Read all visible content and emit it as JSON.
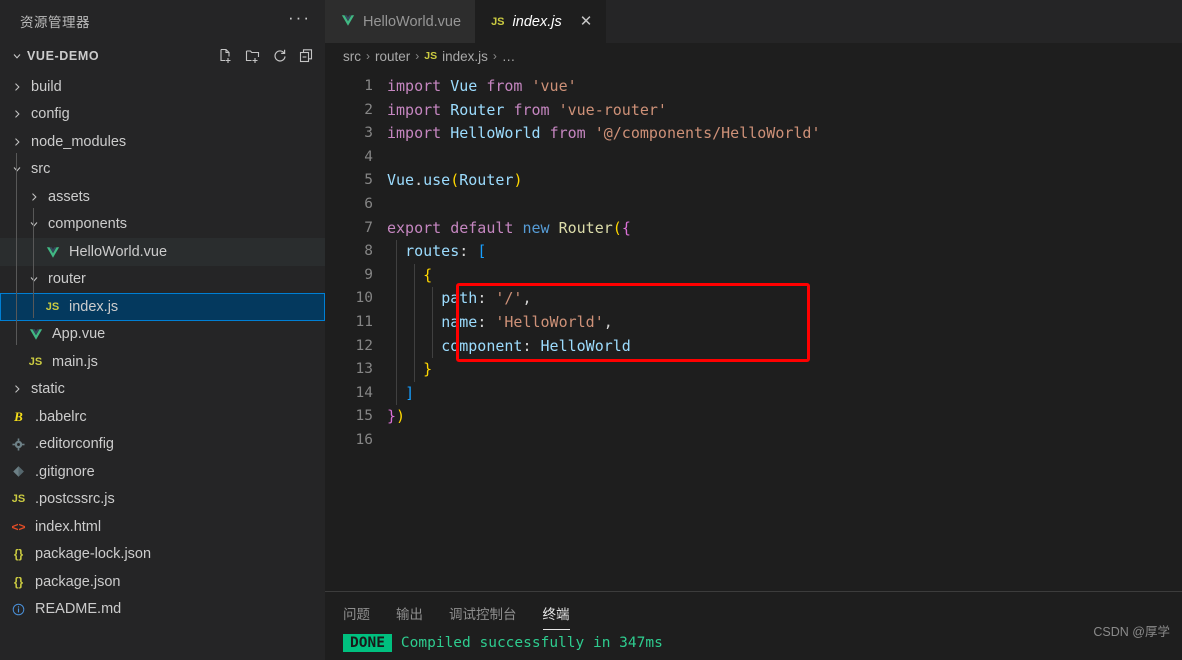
{
  "sidebar": {
    "title": "资源管理器",
    "more_label": "···",
    "project": {
      "name": "VUE-DEMO",
      "actions": [
        {
          "name": "new-file-icon",
          "label": "新建文件"
        },
        {
          "name": "new-folder-icon",
          "label": "新建文件夹"
        },
        {
          "name": "refresh-icon",
          "label": "刷新"
        },
        {
          "name": "collapse-all-icon",
          "label": "折叠"
        }
      ]
    },
    "tree": [
      {
        "label": "build",
        "kind": "folder",
        "expanded": false,
        "depth": 1,
        "icon": "chevron-right",
        "state": "normal"
      },
      {
        "label": "config",
        "kind": "folder",
        "expanded": false,
        "depth": 1,
        "icon": "chevron-right",
        "state": "normal"
      },
      {
        "label": "node_modules",
        "kind": "folder",
        "expanded": false,
        "depth": 1,
        "icon": "chevron-right",
        "state": "normal"
      },
      {
        "label": "src",
        "kind": "folder",
        "expanded": true,
        "depth": 1,
        "icon": "chevron-down",
        "state": "normal"
      },
      {
        "label": "assets",
        "kind": "folder",
        "expanded": false,
        "depth": 2,
        "icon": "chevron-right",
        "state": "normal"
      },
      {
        "label": "components",
        "kind": "folder",
        "expanded": true,
        "depth": 2,
        "icon": "chevron-down",
        "state": "normal"
      },
      {
        "label": "HelloWorld.vue",
        "kind": "file",
        "depth": 3,
        "icon": "vue",
        "state": "hover"
      },
      {
        "label": "router",
        "kind": "folder",
        "expanded": true,
        "depth": 2,
        "icon": "chevron-down",
        "state": "normal"
      },
      {
        "label": "index.js",
        "kind": "file",
        "depth": 3,
        "icon": "js",
        "state": "selected"
      },
      {
        "label": "App.vue",
        "kind": "file",
        "depth": 2,
        "icon": "vue",
        "state": "normal"
      },
      {
        "label": "main.js",
        "kind": "file",
        "depth": 2,
        "icon": "js",
        "state": "normal"
      },
      {
        "label": "static",
        "kind": "folder",
        "expanded": false,
        "depth": 1,
        "icon": "chevron-right",
        "state": "normal"
      },
      {
        "label": ".babelrc",
        "kind": "file",
        "depth": 1,
        "icon": "babel",
        "state": "normal"
      },
      {
        "label": ".editorconfig",
        "kind": "file",
        "depth": 1,
        "icon": "gear",
        "state": "normal"
      },
      {
        "label": ".gitignore",
        "kind": "file",
        "depth": 1,
        "icon": "git",
        "state": "normal"
      },
      {
        "label": ".postcssrc.js",
        "kind": "file",
        "depth": 1,
        "icon": "js",
        "state": "normal"
      },
      {
        "label": "index.html",
        "kind": "file",
        "depth": 1,
        "icon": "html",
        "state": "normal"
      },
      {
        "label": "package-lock.json",
        "kind": "file",
        "depth": 1,
        "icon": "json",
        "state": "normal"
      },
      {
        "label": "package.json",
        "kind": "file",
        "depth": 1,
        "icon": "json",
        "state": "normal"
      },
      {
        "label": "README.md",
        "kind": "file",
        "depth": 1,
        "icon": "info",
        "state": "normal"
      }
    ]
  },
  "tabs": [
    {
      "label": "HelloWorld.vue",
      "icon": "vue",
      "active": false,
      "closable": false
    },
    {
      "label": "index.js",
      "icon": "js",
      "active": true,
      "closable": true,
      "close_glyph": "✕"
    }
  ],
  "breadcrumb": {
    "items": [
      "src",
      "router",
      "index.js",
      "…"
    ],
    "file_icon": "JS",
    "separator": "›"
  },
  "editor": {
    "first_line": 1,
    "lines": [
      {
        "n": 1,
        "tokens": [
          {
            "t": "import",
            "c": "kw"
          },
          {
            "t": " ",
            "c": "w"
          },
          {
            "t": "Vue",
            "c": "var"
          },
          {
            "t": " ",
            "c": "w"
          },
          {
            "t": "from",
            "c": "kw"
          },
          {
            "t": " ",
            "c": "w"
          },
          {
            "t": "'vue'",
            "c": "str"
          }
        ]
      },
      {
        "n": 2,
        "tokens": [
          {
            "t": "import",
            "c": "kw"
          },
          {
            "t": " ",
            "c": "w"
          },
          {
            "t": "Router",
            "c": "var"
          },
          {
            "t": " ",
            "c": "w"
          },
          {
            "t": "from",
            "c": "kw"
          },
          {
            "t": " ",
            "c": "w"
          },
          {
            "t": "'vue-router'",
            "c": "str"
          }
        ]
      },
      {
        "n": 3,
        "tokens": [
          {
            "t": "import",
            "c": "kw"
          },
          {
            "t": " ",
            "c": "w"
          },
          {
            "t": "HelloWorld",
            "c": "var"
          },
          {
            "t": " ",
            "c": "w"
          },
          {
            "t": "from",
            "c": "kw"
          },
          {
            "t": " ",
            "c": "w"
          },
          {
            "t": "'@/components/HelloWorld'",
            "c": "str"
          }
        ]
      },
      {
        "n": 4,
        "tokens": []
      },
      {
        "n": 5,
        "tokens": [
          {
            "t": "Vue",
            "c": "var"
          },
          {
            "t": ".",
            "c": "w"
          },
          {
            "t": "use",
            "c": "var"
          },
          {
            "t": "(",
            "c": "y"
          },
          {
            "t": "Router",
            "c": "var"
          },
          {
            "t": ")",
            "c": "y"
          }
        ]
      },
      {
        "n": 6,
        "tokens": []
      },
      {
        "n": 7,
        "tokens": [
          {
            "t": "export",
            "c": "kw"
          },
          {
            "t": " ",
            "c": "w"
          },
          {
            "t": "default",
            "c": "kw"
          },
          {
            "t": " ",
            "c": "w"
          },
          {
            "t": "new",
            "c": "blue"
          },
          {
            "t": " ",
            "c": "w"
          },
          {
            "t": "Router",
            "c": "fn"
          },
          {
            "t": "(",
            "c": "y"
          },
          {
            "t": "{",
            "c": "p"
          }
        ]
      },
      {
        "n": 8,
        "tokens": [
          {
            "t": "  ",
            "c": "w"
          },
          {
            "t": "routes",
            "c": "var"
          },
          {
            "t": ": ",
            "c": "w"
          },
          {
            "t": "[",
            "c": "b"
          }
        ]
      },
      {
        "n": 9,
        "tokens": [
          {
            "t": "    ",
            "c": "w"
          },
          {
            "t": "{",
            "c": "y"
          }
        ]
      },
      {
        "n": 10,
        "tokens": [
          {
            "t": "      ",
            "c": "w"
          },
          {
            "t": "path",
            "c": "var"
          },
          {
            "t": ": ",
            "c": "w"
          },
          {
            "t": "'/'",
            "c": "str"
          },
          {
            "t": ",",
            "c": "w"
          }
        ]
      },
      {
        "n": 11,
        "tokens": [
          {
            "t": "      ",
            "c": "w"
          },
          {
            "t": "name",
            "c": "var"
          },
          {
            "t": ": ",
            "c": "w"
          },
          {
            "t": "'HelloWorld'",
            "c": "str"
          },
          {
            "t": ",",
            "c": "w"
          }
        ]
      },
      {
        "n": 12,
        "tokens": [
          {
            "t": "      ",
            "c": "w"
          },
          {
            "t": "component",
            "c": "var"
          },
          {
            "t": ": ",
            "c": "w"
          },
          {
            "t": "HelloWorld",
            "c": "var"
          }
        ]
      },
      {
        "n": 13,
        "tokens": [
          {
            "t": "    ",
            "c": "w"
          },
          {
            "t": "}",
            "c": "y"
          }
        ]
      },
      {
        "n": 14,
        "tokens": [
          {
            "t": "  ",
            "c": "w"
          },
          {
            "t": "]",
            "c": "b"
          }
        ]
      },
      {
        "n": 15,
        "tokens": [
          {
            "t": "}",
            "c": "p"
          },
          {
            "t": ")",
            "c": "y"
          }
        ]
      },
      {
        "n": 16,
        "tokens": []
      }
    ],
    "annotation": {
      "name": "red-highlight-box",
      "color": "#ff0000",
      "covers_lines": [
        10,
        11,
        12
      ]
    }
  },
  "panel": {
    "tabs": [
      {
        "label": "问题",
        "active": false
      },
      {
        "label": "输出",
        "active": false
      },
      {
        "label": "调试控制台",
        "active": false
      },
      {
        "label": "终端",
        "active": true
      }
    ],
    "terminal": {
      "badge": "DONE",
      "badge_color": "#00c07f",
      "message": "Compiled successfully in 347ms",
      "message_color": "#2ecc8f"
    }
  },
  "watermark": "CSDN @厚学"
}
